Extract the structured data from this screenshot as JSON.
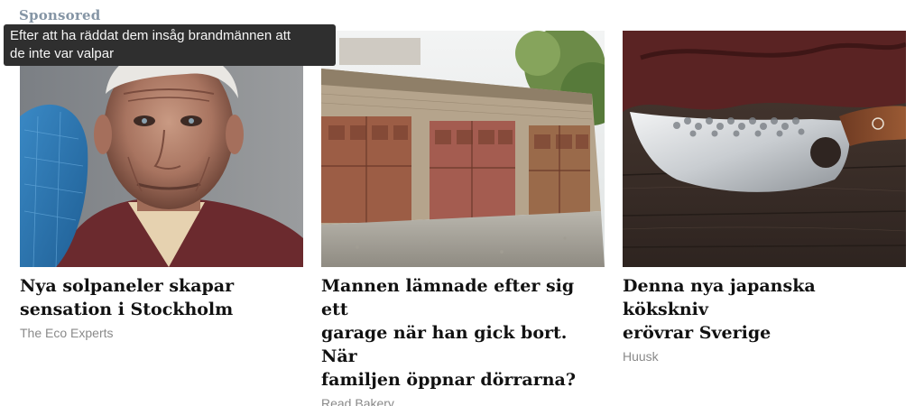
{
  "header": {
    "sponsored_label": "Sponsored"
  },
  "tooltip": {
    "text": "Efter att ha räddat dem insåg brandmännen att\nde inte var valpar"
  },
  "cards": [
    {
      "headline": "Nya solpaneler skapar\nsensation i Stockholm",
      "source": "The Eco Experts",
      "image_subject": "elderly-man-portrait"
    },
    {
      "headline": "Mannen lämnade efter sig ett\ngarage när han gick bort. När\nfamiljen öppnar dörrarna?",
      "source": "Read Bakery",
      "image_subject": "old-garage-doors"
    },
    {
      "headline": "Denna nya japanska kökskniv\nerövrar Sverige",
      "source": "Huusk",
      "image_subject": "hammered-kitchen-knife"
    }
  ],
  "colors": {
    "sponsored": "#8595a5",
    "headline": "#111111",
    "source": "#8a8a8a",
    "tooltip_bg": "#2f2f2f"
  }
}
